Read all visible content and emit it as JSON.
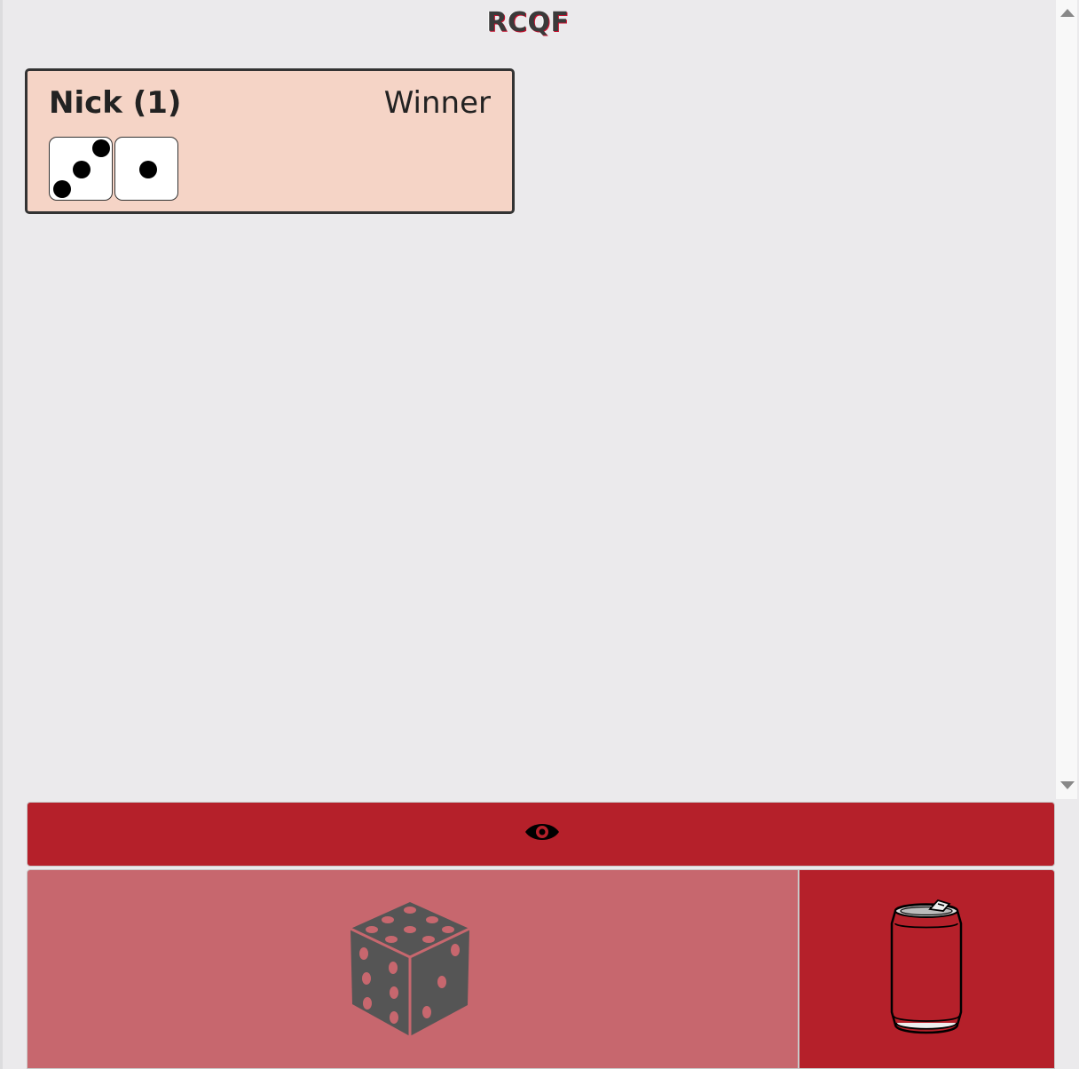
{
  "app": {
    "title": "RCQF"
  },
  "players": [
    {
      "name_label": "Nick (1)",
      "status": "Winner",
      "dice": [
        3,
        1
      ]
    }
  ],
  "actions": {
    "reveal_icon": "eye-icon",
    "roll_icon": "dice-icon",
    "drink_icon": "soda-can-icon"
  },
  "colors": {
    "background": "#ebeaec",
    "card": "#f5d4c6",
    "accent": "#b5202a",
    "accent_light": "#c7676e"
  }
}
